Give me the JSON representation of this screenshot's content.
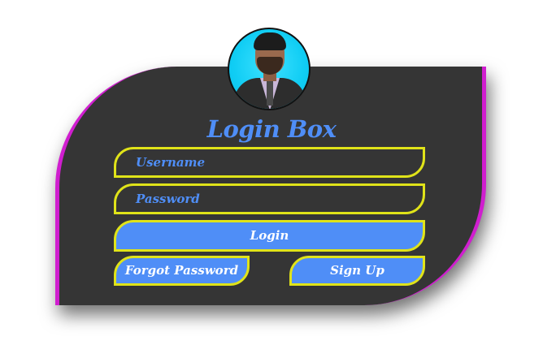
{
  "login_box": {
    "title": "Login Box",
    "username_placeholder": "Username",
    "password_placeholder": "Password",
    "login_label": "Login",
    "forgot_password_label": "Forgot Password",
    "sign_up_label": "Sign Up"
  },
  "colors": {
    "card_background": "#353535",
    "card_edge": "#d01ecf",
    "field_border": "#e0e319",
    "accent": "#4f8ef7",
    "button_text": "#ffffff",
    "avatar_background": "#10cdf4"
  }
}
